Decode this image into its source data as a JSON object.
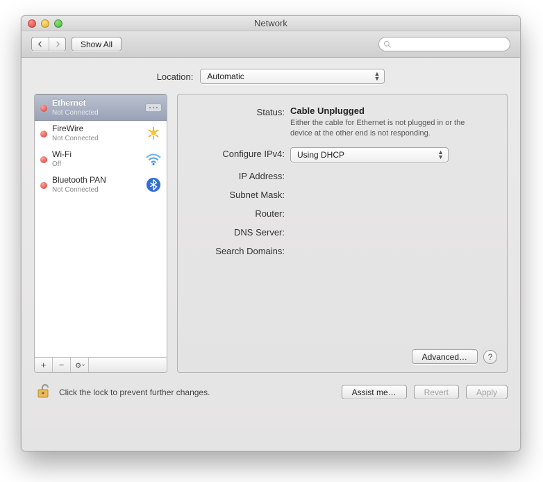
{
  "window": {
    "title": "Network"
  },
  "toolbar": {
    "show_all": "Show All",
    "search_placeholder": ""
  },
  "location": {
    "label": "Location:",
    "value": "Automatic"
  },
  "sidebar": {
    "items": [
      {
        "name": "Ethernet",
        "status": "Not Connected",
        "icon": "ethernet-icon",
        "selected": true
      },
      {
        "name": "FireWire",
        "status": "Not Connected",
        "icon": "firewire-icon",
        "selected": false
      },
      {
        "name": "Wi-Fi",
        "status": "Off",
        "icon": "wifi-icon",
        "selected": false
      },
      {
        "name": "Bluetooth PAN",
        "status": "Not Connected",
        "icon": "bluetooth-icon",
        "selected": false
      }
    ]
  },
  "detail": {
    "status_label": "Status:",
    "status_value": "Cable Unplugged",
    "status_help": "Either the cable for Ethernet is not plugged in or the device at the other end is not responding.",
    "configure_label": "Configure IPv4:",
    "configure_value": "Using DHCP",
    "ip_label": "IP Address:",
    "subnet_label": "Subnet Mask:",
    "router_label": "Router:",
    "dns_label": "DNS Server:",
    "search_label": "Search Domains:",
    "advanced": "Advanced…"
  },
  "footer": {
    "lock_text": "Click the lock to prevent further changes.",
    "assist": "Assist me…",
    "revert": "Revert",
    "apply": "Apply"
  }
}
